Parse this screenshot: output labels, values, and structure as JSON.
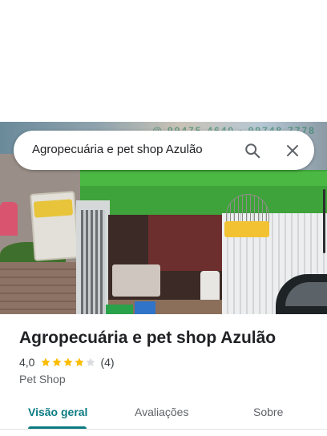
{
  "search": {
    "query": "Agropecuária e pet shop Azulão",
    "search_icon": "search-icon",
    "close_icon": "close-icon"
  },
  "hero": {
    "sign_text": "@ 99475-4640 · 99748-7778"
  },
  "place": {
    "name": "Agropecuária e pet shop Azulão",
    "rating_text": "4,0",
    "rating": 4,
    "rating_max": 5,
    "review_count_text": "(4)",
    "category": "Pet Shop"
  },
  "tabs": [
    {
      "label": "Visão geral",
      "active": true
    },
    {
      "label": "Avaliações",
      "active": false
    },
    {
      "label": "Sobre",
      "active": false
    }
  ],
  "colors": {
    "accent": "#0b7b82",
    "star": "#fbbc04",
    "star_empty": "#dadce0"
  }
}
